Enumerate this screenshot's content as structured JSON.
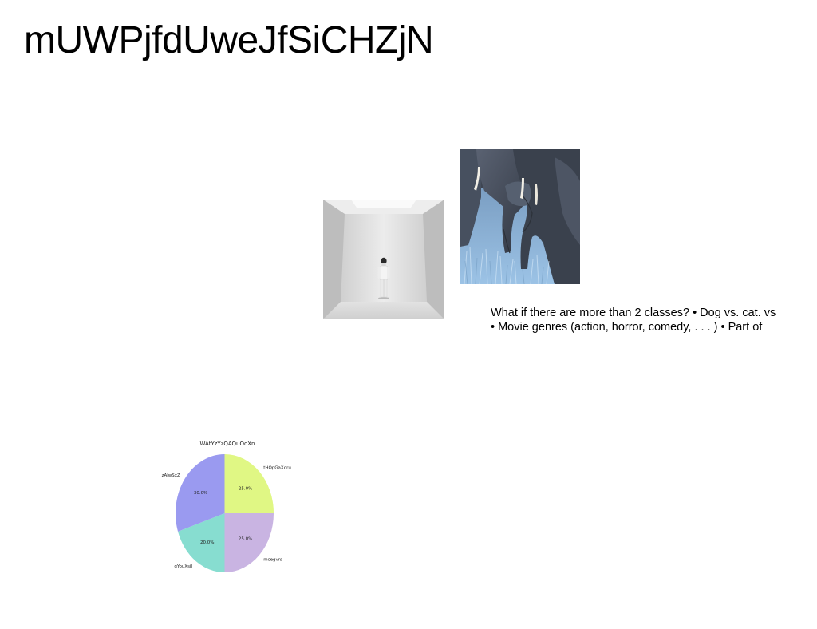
{
  "slide": {
    "title": "mUWPjfdUweJfSiCHZjN"
  },
  "images": [
    {
      "name": "white-room-person-photo"
    },
    {
      "name": "elephants-photo"
    }
  ],
  "caption": {
    "lines": [
      "What if there are more than 2 classes? • Dog vs. cat. vs",
      "• Movie genres (action, horror, comedy, . . . ) • Part of"
    ]
  },
  "chart_data": {
    "type": "pie",
    "title": "WAtYzYzQAQuOoXn",
    "slices": [
      {
        "label": "tHQpGaXoru",
        "value": 25.0,
        "pct_label": "25.0%",
        "color": "#e0f784"
      },
      {
        "label": "mcegvrs",
        "value": 25.0,
        "pct_label": "25.0%",
        "color": "#c9b4e2"
      },
      {
        "label": "gYouXsjl",
        "value": 20.0,
        "pct_label": "20.0%",
        "color": "#87ddd0"
      },
      {
        "label": "zAlwSxZ",
        "value": 30.0,
        "pct_label": "30.0%",
        "color": "#9a9af0"
      }
    ],
    "start_angle_deg": 90,
    "direction": "clockwise"
  }
}
